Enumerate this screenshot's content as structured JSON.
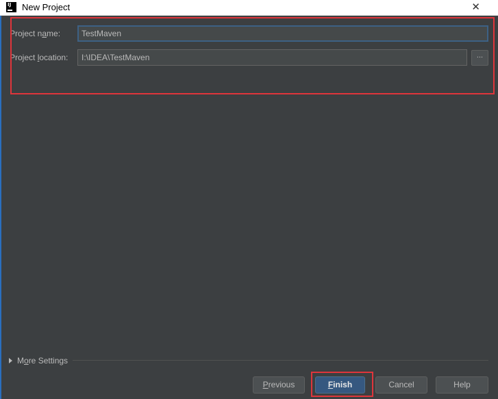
{
  "window": {
    "title": "New Project",
    "close_glyph": "✕",
    "app_icon_text": "IJ"
  },
  "form": {
    "project_name": {
      "label_before": "Project n",
      "label_mnemonic": "a",
      "label_after": "me:",
      "value": "TestMaven"
    },
    "project_location": {
      "label_before": "Project ",
      "label_mnemonic": "l",
      "label_after": "ocation:",
      "value": "I:\\IDEA\\TestMaven",
      "browse_label": "..."
    }
  },
  "more_settings": {
    "label_before": "M",
    "label_mnemonic": "o",
    "label_after": "re Settings",
    "expanded": false
  },
  "buttons": {
    "previous": {
      "mnemonic": "P",
      "rest": "revious"
    },
    "finish": {
      "mnemonic": "F",
      "rest": "inish"
    },
    "cancel": {
      "label": "Cancel"
    },
    "help": {
      "label": "Help"
    }
  },
  "colors": {
    "background": "#3c3f41",
    "text": "#bbbbbb",
    "input_background": "#45494a",
    "focus_border": "#3d6185",
    "primary_button": "#365880",
    "annotation_red": "#e0353b"
  },
  "icons": {
    "app": "intellij-icon",
    "close": "close-icon",
    "expand": "triangle-right-icon"
  }
}
